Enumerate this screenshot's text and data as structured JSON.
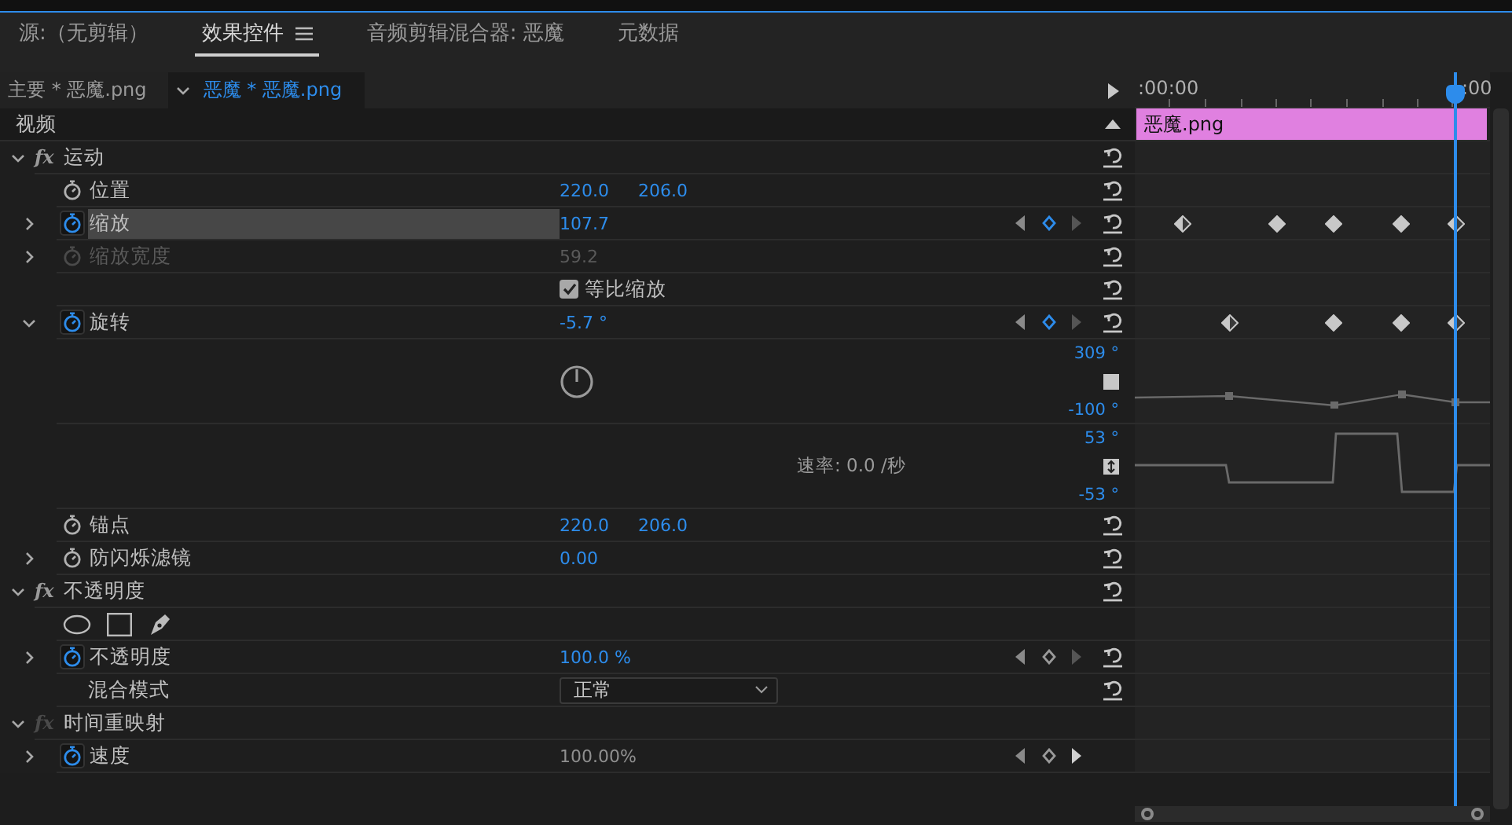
{
  "top_tabs": [
    {
      "label": "源:（无剪辑）",
      "selected": false
    },
    {
      "label": "效果控件",
      "selected": true
    },
    {
      "label": "音频剪辑混合器: 恶魔",
      "selected": false
    },
    {
      "label": "元数据",
      "selected": false
    }
  ],
  "clip_tabs": [
    {
      "label": "主要 * 恶魔.png",
      "selected": false
    },
    {
      "label": "恶魔 * 恶魔.png",
      "selected": true
    }
  ],
  "timeline": {
    "start": ":00:00",
    "end": ":00",
    "clip": "恶魔.png"
  },
  "video_header": "视频",
  "rows": [
    {
      "kind": "section",
      "badge": "fx",
      "name": "运动",
      "expanded": true,
      "fx_enabled": true,
      "reset": true
    },
    {
      "kind": "property",
      "name": "位置",
      "values": [
        "220.0",
        "206.0"
      ],
      "animating": false,
      "selected": false,
      "disabled": false,
      "keyframes": false,
      "reset": true
    },
    {
      "kind": "property",
      "name": "缩放",
      "values": [
        "107.7"
      ],
      "animating": true,
      "expandable": true,
      "expanded": false,
      "selected": true,
      "disabled": false,
      "nav": {
        "on_key": true,
        "next": false
      },
      "keyframes": true,
      "reset": true
    },
    {
      "kind": "property",
      "name": "缩放宽度",
      "values": [
        "59.2"
      ],
      "animating": false,
      "expandable": true,
      "expanded": false,
      "selected": false,
      "disabled": true,
      "keyframes": false,
      "reset": true
    },
    {
      "kind": "checkbox",
      "label": "等比缩放",
      "checked": true,
      "reset": true
    },
    {
      "kind": "property",
      "name": "旋转",
      "values": [
        "-5.7 °"
      ],
      "animating": true,
      "expandable": true,
      "expanded": true,
      "selected": false,
      "disabled": false,
      "nav": {
        "on_key": true,
        "next": false
      },
      "keyframes": true,
      "reset": true
    },
    {
      "kind": "dial",
      "max": "309 °",
      "min": "-100 °"
    },
    {
      "kind": "velocity",
      "rate": "速率: 0.0 /秒",
      "max": "53 °",
      "min": "-53 °"
    },
    {
      "kind": "property",
      "name": "锚点",
      "values": [
        "220.0",
        "206.0"
      ],
      "animating": false,
      "selected": false,
      "disabled": false,
      "keyframes": false,
      "reset": true
    },
    {
      "kind": "property",
      "name": "防闪烁滤镜",
      "values": [
        "0.00"
      ],
      "animating": false,
      "expandable": true,
      "expanded": false,
      "selected": false,
      "disabled": false,
      "keyframes": false,
      "reset": true
    },
    {
      "kind": "section",
      "badge": "fx",
      "name": "不透明度",
      "expanded": true,
      "fx_enabled": true,
      "reset": true
    },
    {
      "kind": "masks"
    },
    {
      "kind": "property",
      "name": "不透明度",
      "values": [
        "100.0 %"
      ],
      "animating": true,
      "expandable": true,
      "expanded": false,
      "selected": false,
      "disabled": false,
      "nav": {
        "on_key": false,
        "next": false
      },
      "keyframes": false,
      "reset": true
    },
    {
      "kind": "dropdown",
      "name": "混合模式",
      "value": "正常",
      "reset": true
    },
    {
      "kind": "section",
      "badge": "fx",
      "name": "时间重映射",
      "expanded": true,
      "fx_enabled": false,
      "reset": false
    },
    {
      "kind": "property",
      "name": "速度",
      "values": [
        "100.00%"
      ],
      "animating": true,
      "expandable": true,
      "expanded": false,
      "selected": false,
      "disabled": false,
      "static": true,
      "nav": {
        "on_key": false,
        "next": true
      },
      "keyframes": false,
      "reset": false
    }
  ]
}
